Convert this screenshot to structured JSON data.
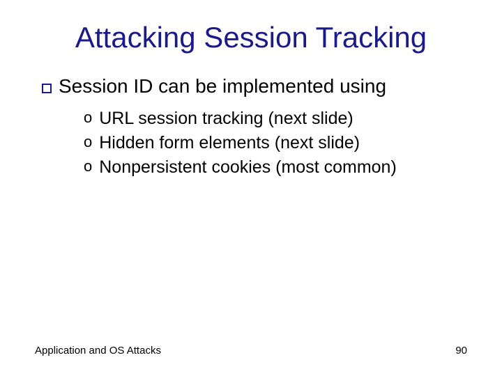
{
  "title": "Attacking Session Tracking",
  "main": {
    "text": "Session ID can be implemented using"
  },
  "subs": {
    "a": "URL session tracking (next slide)",
    "b": "Hidden form elements (next slide)",
    "c": "Nonpersistent cookies (most common)"
  },
  "footer": {
    "left": "Application and OS Attacks",
    "right": "90"
  }
}
